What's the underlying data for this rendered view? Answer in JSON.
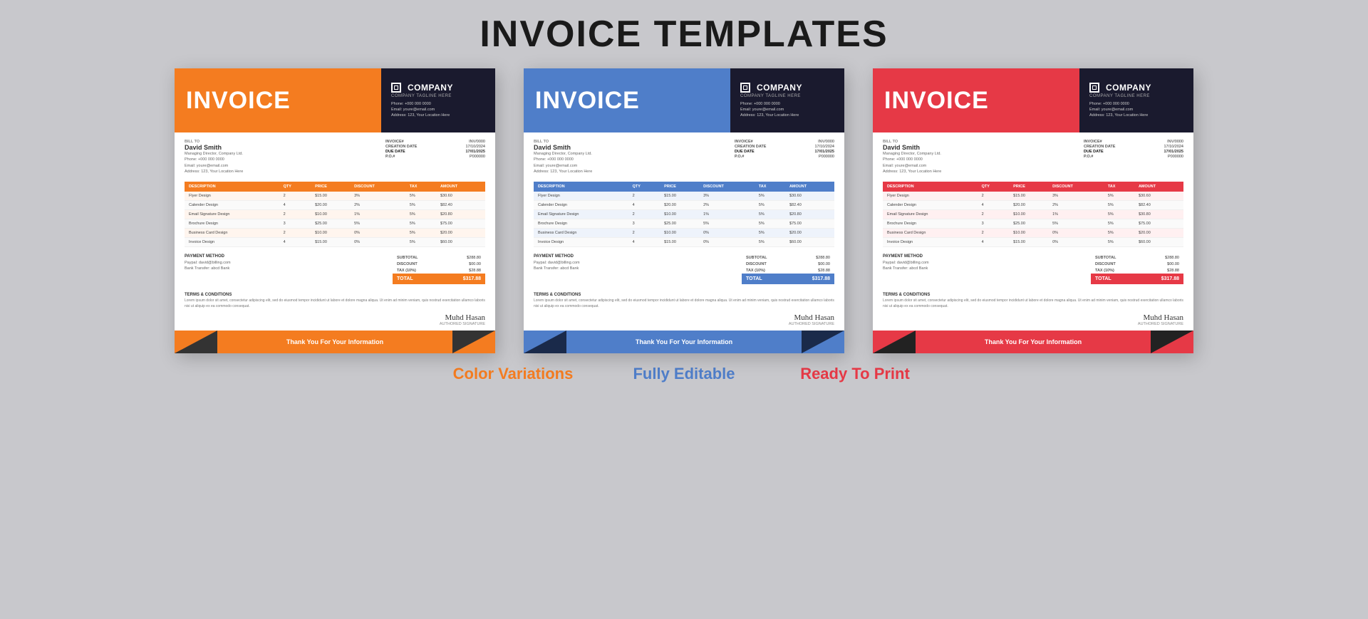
{
  "page": {
    "title": "INVOICE TEMPLATES",
    "background": "#c8c8cc"
  },
  "templates": [
    {
      "id": "orange",
      "theme": "theme-orange",
      "accentColor": "#f47c20",
      "header": {
        "invoiceLabel": "INVOICE",
        "companyName": "COMPANY",
        "companyTagline": "COMPANY TAGLINE HERE",
        "phone": "Phone: +000 000 0000",
        "email": "Email: youre@email.com",
        "address": "Address: 123, Your Location Here"
      },
      "bill": {
        "billToLabel": "BILL TO",
        "clientName": "David Smith",
        "clientTitle": "Managing Director, Company Ltd.",
        "phone": "Phone: +000 000 0000",
        "email": "Email: youre@email.com",
        "address": "Address: 123, Your Location Here"
      },
      "meta": {
        "invoiceLabel": "INVOICE#",
        "invoiceValue": "INV/0000",
        "creationLabel": "CREATION DATE",
        "creationValue": "17/10/2024",
        "dueLabel": "DUE DATE",
        "dueValue": "17/01/2025",
        "poLabel": "P.O.#",
        "poValue": "P000000"
      },
      "tableHeaders": [
        "DESCRIPTION",
        "QTY",
        "PRICE",
        "DISCOUNT",
        "TAX",
        "AMOUNT"
      ],
      "tableRows": [
        [
          "Flyer Design",
          "2",
          "$15.00",
          "3%",
          "5%",
          "$30.60"
        ],
        [
          "Calender Design",
          "4",
          "$20.00",
          "2%",
          "5%",
          "$82.40"
        ],
        [
          "Email Signature Design",
          "2",
          "$10.00",
          "1%",
          "5%",
          "$20.80"
        ],
        [
          "Brochure Design",
          "3",
          "$25.00",
          "5%",
          "5%",
          "$75.00"
        ],
        [
          "Business Card Design",
          "2",
          "$10.00",
          "0%",
          "5%",
          "$20.00"
        ],
        [
          "Invoice Design",
          "4",
          "$15.00",
          "0%",
          "5%",
          "$60.00"
        ]
      ],
      "summary": {
        "subtotalLabel": "SUBTOTAL",
        "subtotalValue": "$288.80",
        "discountLabel": "DISCOUNT",
        "discountValue": "$00.00",
        "taxLabel": "TAX (10%)",
        "taxValue": "$28.88",
        "totalLabel": "TOTAL",
        "totalValue": "$317.88"
      },
      "payment": {
        "label": "PAYMENT METHOD",
        "detail1": "Paypal: david@billing.com",
        "detail2": "Bank Transfer: abcd Bank"
      },
      "terms": {
        "label": "TERMS & CONDITIONS",
        "text": "Lorem ipsum dolor sit amet, consectetur adipiscing elit, sed do eiusmod tempor incididunt ut labore et dolore magna aliqua. Ut enim ad minim veniam, quis nostrud exercitation ullamco laboris nisi ut aliquip ex ea commodo consequat."
      },
      "signature": {
        "text": "Muhd Hasan",
        "label": "Authored Signature"
      },
      "footer": {
        "text": "Thank You For Your Information"
      }
    },
    {
      "id": "blue",
      "theme": "theme-blue",
      "accentColor": "#4f7ec9",
      "header": {
        "invoiceLabel": "INVOICE",
        "companyName": "COMPANY",
        "companyTagline": "COMPANY TAGLINE HERE",
        "phone": "Phone: +000 000 0000",
        "email": "Email: youre@email.com",
        "address": "Address: 123, Your Location Here"
      },
      "bill": {
        "billToLabel": "BILL TO",
        "clientName": "David Smith",
        "clientTitle": "Managing Director, Company Ltd.",
        "phone": "Phone: +000 000 0000",
        "email": "Email: youre@email.com",
        "address": "Address: 123, Your Location Here"
      },
      "meta": {
        "invoiceLabel": "INVOICE#",
        "invoiceValue": "INV/0000",
        "creationLabel": "CREATION DATE",
        "creationValue": "17/10/2024",
        "dueLabel": "DUE DATE",
        "dueValue": "17/01/2025",
        "poLabel": "P.O.#",
        "poValue": "P000000"
      },
      "tableHeaders": [
        "DESCRIPTION",
        "QTY",
        "PRICE",
        "DISCOUNT",
        "TAX",
        "AMOUNT"
      ],
      "tableRows": [
        [
          "Flyer Design",
          "2",
          "$15.00",
          "3%",
          "5%",
          "$30.60"
        ],
        [
          "Calender Design",
          "4",
          "$20.00",
          "2%",
          "5%",
          "$82.40"
        ],
        [
          "Email Signature Design",
          "2",
          "$10.00",
          "1%",
          "5%",
          "$20.80"
        ],
        [
          "Brochure Design",
          "3",
          "$25.00",
          "5%",
          "5%",
          "$75.00"
        ],
        [
          "Business Card Design",
          "2",
          "$10.00",
          "0%",
          "5%",
          "$20.00"
        ],
        [
          "Invoice Design",
          "4",
          "$15.00",
          "0%",
          "5%",
          "$60.00"
        ]
      ],
      "summary": {
        "subtotalLabel": "SUBTOTAL",
        "subtotalValue": "$288.80",
        "discountLabel": "DISCOUNT",
        "discountValue": "$00.00",
        "taxLabel": "TAX (10%)",
        "taxValue": "$28.88",
        "totalLabel": "TOTAL",
        "totalValue": "$317.88"
      },
      "payment": {
        "label": "PAYMENT METHOD",
        "detail1": "Paypal: david@billing.com",
        "detail2": "Bank Transfer: abcd Bank"
      },
      "terms": {
        "label": "TERMS & CONDITIONS",
        "text": "Lorem ipsum dolor sit amet, consectetur adipiscing elit, sed do eiusmod tempor incididunt ut labore et dolore magna aliqua. Ut enim ad minim veniam, quis nostrud exercitation ullamco laboris nisi ut aliquip ex ea commodo consequat."
      },
      "signature": {
        "text": "Muhd Hasan",
        "label": "Authored Signature"
      },
      "footer": {
        "text": "Thank You For Your Information"
      }
    },
    {
      "id": "red",
      "theme": "theme-red",
      "accentColor": "#e63946",
      "header": {
        "invoiceLabel": "INVOICE",
        "companyName": "COMPANY",
        "companyTagline": "COMPANY TAGLINE HERE",
        "phone": "Phone: +000 000 0000",
        "email": "Email: youre@email.com",
        "address": "Address: 123, Your Location Here"
      },
      "bill": {
        "billToLabel": "BILL TO",
        "clientName": "David Smith",
        "clientTitle": "Managing Director, Company Ltd.",
        "phone": "Phone: +000 000 0000",
        "email": "Email: youre@email.com",
        "address": "Address: 123, Your Location Here"
      },
      "meta": {
        "invoiceLabel": "INVOICE#",
        "invoiceValue": "INV/0000",
        "creationLabel": "CREATION DATE",
        "creationValue": "17/10/2024",
        "dueLabel": "DUE DATE",
        "dueValue": "17/01/2025",
        "poLabel": "P.O.#",
        "poValue": "P000000"
      },
      "tableHeaders": [
        "DESCRIPTION",
        "QTY",
        "PRICE",
        "DISCOUNT",
        "TAX",
        "AMOUNT"
      ],
      "tableRows": [
        [
          "Flyer Design",
          "2",
          "$15.00",
          "3%",
          "5%",
          "$30.60"
        ],
        [
          "Calender Design",
          "4",
          "$20.00",
          "2%",
          "5%",
          "$82.40"
        ],
        [
          "Email Signature Design",
          "2",
          "$10.00",
          "1%",
          "5%",
          "$30.80"
        ],
        [
          "Brochure Design",
          "3",
          "$25.00",
          "5%",
          "5%",
          "$75.00"
        ],
        [
          "Business Card Design",
          "2",
          "$10.00",
          "0%",
          "5%",
          "$20.00"
        ],
        [
          "Invoice Design",
          "4",
          "$15.00",
          "0%",
          "5%",
          "$60.00"
        ]
      ],
      "summary": {
        "subtotalLabel": "SUBTOTAL",
        "subtotalValue": "$288.80",
        "discountLabel": "DISCOUNT",
        "discountValue": "$00.00",
        "taxLabel": "TAX (10%)",
        "taxValue": "$28.88",
        "totalLabel": "TOTAL",
        "totalValue": "$317.88"
      },
      "payment": {
        "label": "PAYMENT METHOD",
        "detail1": "Paypal: david@billing.com",
        "detail2": "Bank Transfer: abcd Bank"
      },
      "terms": {
        "label": "TERMS & CONDITIONS",
        "text": "Lorem ipsum dolor sit amet, consectetur adipiscing elit, sed do eiusmod tempor incididunt ut labore et dolore magna aliqua. Ut enim ad minim veniam, quis nostrud exercitation ullamco laboris nisi ut aliquip ex ea commodo consequat."
      },
      "signature": {
        "text": "Muhd Hasan",
        "label": "Authored Signature"
      },
      "footer": {
        "text": "Thank You For Your Information"
      }
    }
  ],
  "features": [
    {
      "label": "Color Variations",
      "colorClass": "feature-orange"
    },
    {
      "label": "Fully Editable",
      "colorClass": "feature-blue"
    },
    {
      "label": "Ready To Print",
      "colorClass": "feature-red"
    }
  ]
}
